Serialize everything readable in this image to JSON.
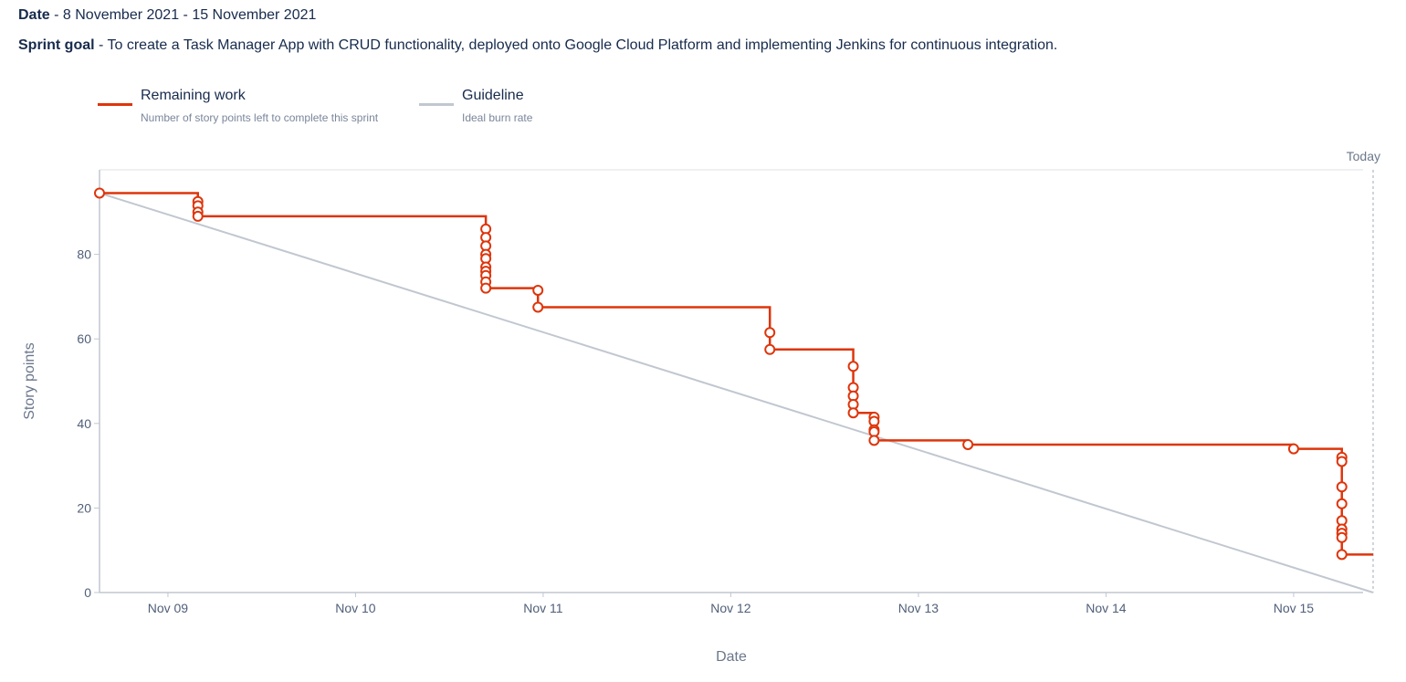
{
  "header": {
    "date_label": "Date",
    "date_value": "8 November 2021 - 15 November 2021",
    "goal_label": "Sprint goal",
    "goal_value": "To create a Task Manager App with CRUD functionality, deployed onto Google Cloud Platform and implementing Jenkins for continuous integration.",
    "separator": " - "
  },
  "legend": [
    {
      "title": "Remaining work",
      "desc": "Number of story points left to complete this sprint",
      "color": "#de350b"
    },
    {
      "title": "Guideline",
      "desc": "Ideal burn rate",
      "color": "#c1c7d0"
    }
  ],
  "chart_data": {
    "type": "line",
    "title": "",
    "xlabel": "Date",
    "ylabel": "Story points",
    "x_ticks": [
      "Nov 09",
      "Nov 10",
      "Nov 11",
      "Nov 12",
      "Nov 13",
      "Nov 14",
      "Nov 15"
    ],
    "y_ticks": [
      0,
      20,
      40,
      60,
      80
    ],
    "xlim": [
      "2021-11-08 15:15",
      "2021-11-15 10:10"
    ],
    "ylim": [
      0,
      100
    ],
    "today_label": "Today",
    "today_x": "2021-11-15 10:10",
    "grid": false,
    "legend_position": "top-left",
    "series": [
      {
        "name": "Remaining work",
        "color": "#de350b",
        "line_style": "step",
        "points": [
          {
            "x": "2021-11-08 15:15",
            "y": 94.5
          },
          {
            "x": "2021-11-09 03:50",
            "y": 92.5
          },
          {
            "x": "2021-11-09 03:50",
            "y": 91.5
          },
          {
            "x": "2021-11-09 03:50",
            "y": 90
          },
          {
            "x": "2021-11-09 03:50",
            "y": 89
          },
          {
            "x": "2021-11-10 16:40",
            "y": 86
          },
          {
            "x": "2021-11-10 16:40",
            "y": 84
          },
          {
            "x": "2021-11-10 16:40",
            "y": 82
          },
          {
            "x": "2021-11-10 16:40",
            "y": 80
          },
          {
            "x": "2021-11-10 16:40",
            "y": 79
          },
          {
            "x": "2021-11-10 16:40",
            "y": 77
          },
          {
            "x": "2021-11-10 16:40",
            "y": 76
          },
          {
            "x": "2021-11-10 16:40",
            "y": 75
          },
          {
            "x": "2021-11-10 16:40",
            "y": 73.5
          },
          {
            "x": "2021-11-10 16:40",
            "y": 72
          },
          {
            "x": "2021-11-10 23:20",
            "y": 71.5
          },
          {
            "x": "2021-11-10 23:20",
            "y": 67.5
          },
          {
            "x": "2021-11-12 05:00",
            "y": 61.5
          },
          {
            "x": "2021-11-12 05:00",
            "y": 57.5
          },
          {
            "x": "2021-11-12 15:40",
            "y": 53.5
          },
          {
            "x": "2021-11-12 15:40",
            "y": 48.5
          },
          {
            "x": "2021-11-12 15:40",
            "y": 46.5
          },
          {
            "x": "2021-11-12 15:40",
            "y": 44.5
          },
          {
            "x": "2021-11-12 15:40",
            "y": 42.5
          },
          {
            "x": "2021-11-12 18:20",
            "y": 41.5
          },
          {
            "x": "2021-11-12 18:20",
            "y": 40.5
          },
          {
            "x": "2021-11-12 18:20",
            "y": 38.5
          },
          {
            "x": "2021-11-12 18:20",
            "y": 38
          },
          {
            "x": "2021-11-12 18:20",
            "y": 36
          },
          {
            "x": "2021-11-13 06:20",
            "y": 35
          },
          {
            "x": "2021-11-15 00:00",
            "y": 34
          },
          {
            "x": "2021-11-15 06:10",
            "y": 32
          },
          {
            "x": "2021-11-15 06:10",
            "y": 31
          },
          {
            "x": "2021-11-15 06:10",
            "y": 25
          },
          {
            "x": "2021-11-15 06:10",
            "y": 21
          },
          {
            "x": "2021-11-15 06:10",
            "y": 17
          },
          {
            "x": "2021-11-15 06:10",
            "y": 15
          },
          {
            "x": "2021-11-15 06:10",
            "y": 14
          },
          {
            "x": "2021-11-15 06:10",
            "y": 13
          },
          {
            "x": "2021-11-15 06:10",
            "y": 9
          }
        ]
      },
      {
        "name": "Guideline",
        "color": "#c1c7d0",
        "line_style": "straight",
        "points": [
          {
            "x": "2021-11-08 15:15",
            "y": 94.5
          },
          {
            "x": "2021-11-15 10:10",
            "y": 0
          }
        ]
      }
    ]
  }
}
